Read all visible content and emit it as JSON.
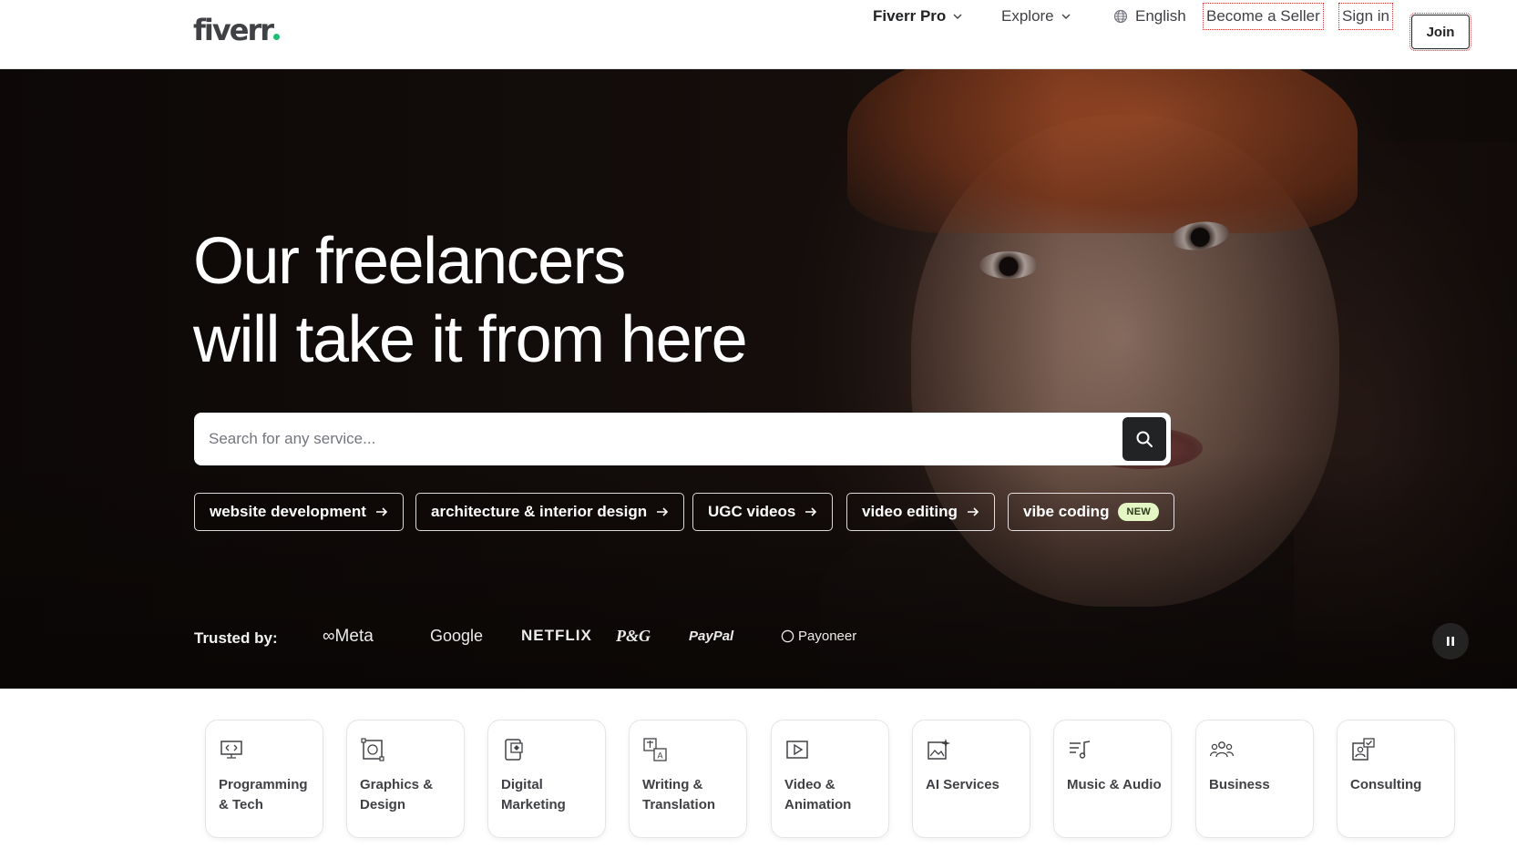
{
  "header": {
    "logo": "fiverr",
    "nav": {
      "fiverr_pro": "Fiverr Pro",
      "explore": "Explore",
      "language": "English",
      "become_seller": "Become a Seller",
      "sign_in": "Sign in",
      "join": "Join"
    }
  },
  "hero": {
    "headline_line1": "Our freelancers",
    "headline_line2": "will take it from here",
    "search": {
      "placeholder": "Search for any service..."
    },
    "pills": [
      {
        "label": "website development",
        "icon": "arrow-right-icon"
      },
      {
        "label": "architecture & interior design",
        "icon": "arrow-right-icon"
      },
      {
        "label": "UGC videos",
        "icon": "arrow-right-icon"
      },
      {
        "label": "video editing",
        "icon": "arrow-right-icon"
      },
      {
        "label": "vibe coding",
        "badge": "NEW"
      }
    ],
    "trusted_by": {
      "label": "Trusted by:",
      "brands": [
        "Meta",
        "Google",
        "NETFLIX",
        "P&G",
        "PayPal",
        "Payoneer"
      ]
    }
  },
  "categories": [
    {
      "label": "Programming & Tech",
      "icon": "programming-icon"
    },
    {
      "label": "Graphics & Design",
      "icon": "graphics-icon"
    },
    {
      "label": "Digital Marketing",
      "icon": "marketing-icon"
    },
    {
      "label": "Writing & Translation",
      "icon": "translation-icon"
    },
    {
      "label": "Video & Animation",
      "icon": "video-icon"
    },
    {
      "label": "AI Services",
      "icon": "ai-icon"
    },
    {
      "label": "Music & Audio",
      "icon": "music-icon"
    },
    {
      "label": "Business",
      "icon": "business-icon"
    },
    {
      "label": "Consulting",
      "icon": "consulting-icon"
    }
  ],
  "colors": {
    "accent_green": "#1dbf73",
    "text_dark": "#222325",
    "badge_bg": "#e4f6c4"
  }
}
